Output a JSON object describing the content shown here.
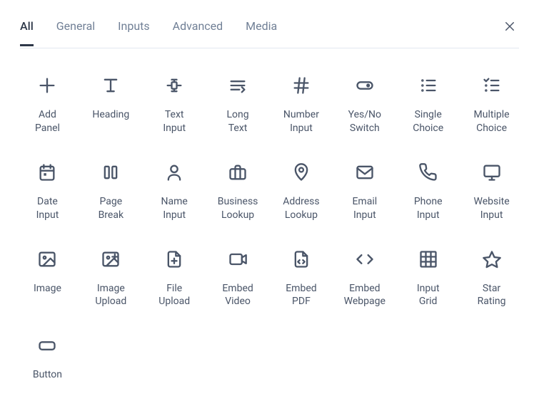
{
  "tabs": [
    {
      "id": "all",
      "label": "All",
      "active": true
    },
    {
      "id": "general",
      "label": "General",
      "active": false
    },
    {
      "id": "inputs",
      "label": "Inputs",
      "active": false
    },
    {
      "id": "advanced",
      "label": "Advanced",
      "active": false
    },
    {
      "id": "media",
      "label": "Media",
      "active": false
    }
  ],
  "items": [
    {
      "id": "add-panel",
      "label": "Add\nPanel",
      "icon": "plus-icon"
    },
    {
      "id": "heading",
      "label": "Heading",
      "icon": "heading-icon"
    },
    {
      "id": "text-input",
      "label": "Text\nInput",
      "icon": "text-input-icon"
    },
    {
      "id": "long-text",
      "label": "Long\nText",
      "icon": "long-text-icon"
    },
    {
      "id": "number-input",
      "label": "Number\nInput",
      "icon": "hash-icon"
    },
    {
      "id": "yes-no-switch",
      "label": "Yes/No\nSwitch",
      "icon": "toggle-icon"
    },
    {
      "id": "single-choice",
      "label": "Single\nChoice",
      "icon": "list-icon"
    },
    {
      "id": "multiple-choice",
      "label": "Multiple\nChoice",
      "icon": "checklist-icon"
    },
    {
      "id": "date-input",
      "label": "Date\nInput",
      "icon": "calendar-icon"
    },
    {
      "id": "page-break",
      "label": "Page\nBreak",
      "icon": "page-break-icon"
    },
    {
      "id": "name-input",
      "label": "Name\nInput",
      "icon": "user-icon"
    },
    {
      "id": "business-lookup",
      "label": "Business\nLookup",
      "icon": "briefcase-icon"
    },
    {
      "id": "address-lookup",
      "label": "Address\nLookup",
      "icon": "map-pin-icon"
    },
    {
      "id": "email-input",
      "label": "Email\nInput",
      "icon": "mail-icon"
    },
    {
      "id": "phone-input",
      "label": "Phone\nInput",
      "icon": "phone-icon"
    },
    {
      "id": "website-input",
      "label": "Website\nInput",
      "icon": "monitor-icon"
    },
    {
      "id": "image",
      "label": "Image",
      "icon": "image-icon"
    },
    {
      "id": "image-upload",
      "label": "Image\nUpload",
      "icon": "image-upload-icon"
    },
    {
      "id": "file-upload",
      "label": "File\nUpload",
      "icon": "file-upload-icon"
    },
    {
      "id": "embed-video",
      "label": "Embed\nVideo",
      "icon": "video-icon"
    },
    {
      "id": "embed-pdf",
      "label": "Embed\nPDF",
      "icon": "file-code-icon"
    },
    {
      "id": "embed-webpage",
      "label": "Embed\nWebpage",
      "icon": "code-icon"
    },
    {
      "id": "input-grid",
      "label": "Input\nGrid",
      "icon": "grid-icon"
    },
    {
      "id": "star-rating",
      "label": "Star\nRating",
      "icon": "star-icon"
    },
    {
      "id": "button",
      "label": "Button",
      "icon": "button-icon"
    }
  ]
}
